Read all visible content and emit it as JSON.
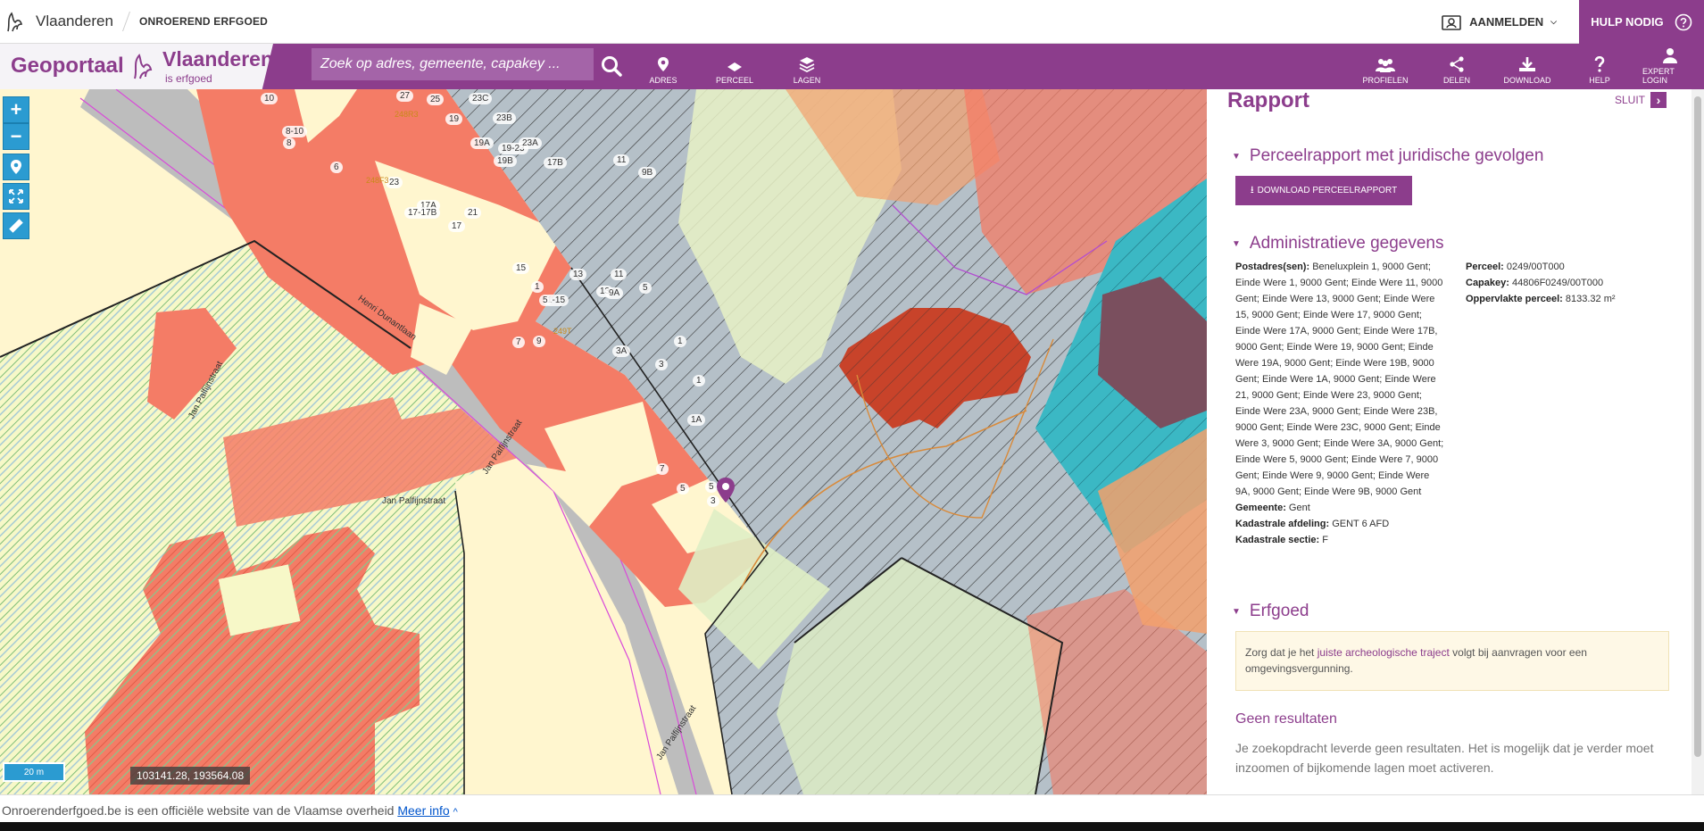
{
  "topbar": {
    "brand": "Vlaanderen",
    "site": "ONROEREND ERFGOED",
    "login": "AANMELDEN",
    "help": "HULP NODIG"
  },
  "header": {
    "geoportaal": "Geoportaal",
    "vlaanderen": "Vlaanderen",
    "is_erfgoed": "is erfgoed",
    "search_placeholder": "Zoek op adres, gemeente, capakey ...",
    "buttons": {
      "adres": "ADRES",
      "perceel": "PERCEEL",
      "lagen": "LAGEN",
      "profielen": "PROFIELEN",
      "delen": "DELEN",
      "download": "DOWNLOAD",
      "help": "HELP",
      "expert_login": "EXPERT LOGIN"
    }
  },
  "map": {
    "coordinates": "103141.28, 193564.08",
    "scale": "20 m",
    "streets": [
      "Henri Dunantlaan",
      "Jan Palfijnstraat",
      "Jan Palfijnstraat",
      "Jan Palfijnstraat",
      "Jan Palfijnstraat"
    ],
    "house_numbers": [
      "10",
      "8-10",
      "8",
      "27",
      "25",
      "23C",
      "19",
      "23B",
      "19A",
      "19-23",
      "23A",
      "19B",
      "6",
      "17B",
      "23",
      "17A",
      "17-17B",
      "21",
      "17",
      "11",
      "9B",
      "15",
      "13",
      "11",
      "1",
      "1-15",
      "13",
      "5",
      "9A",
      "5",
      "9",
      "7",
      "3A",
      "1",
      "3",
      "1",
      "1A",
      "7",
      "5",
      "5",
      "3"
    ],
    "parcel_labels": [
      "248R3",
      "248F3",
      "249T"
    ]
  },
  "panel": {
    "title": "Rapport",
    "close": "SLUIT",
    "section_perceel": "Perceelrapport met juridische gevolgen",
    "download_button": "DOWNLOAD PERCEELRAPPORT",
    "section_admin": "Administratieve gegevens",
    "postadres_label": "Postadres(sen):",
    "postadres_value": "Beneluxplein 1, 9000 Gent; Einde Were 1, 9000 Gent; Einde Were 11, 9000 Gent; Einde Were 13, 9000 Gent; Einde Were 15, 9000 Gent; Einde Were 17, 9000 Gent; Einde Were 17A, 9000 Gent; Einde Were 17B, 9000 Gent; Einde Were 19, 9000 Gent; Einde Were 19A, 9000 Gent; Einde Were 19B, 9000 Gent; Einde Were 1A, 9000 Gent; Einde Were 21, 9000 Gent; Einde Were 23, 9000 Gent; Einde Were 23A, 9000 Gent; Einde Were 23B, 9000 Gent; Einde Were 23C, 9000 Gent; Einde Were 3, 9000 Gent; Einde Were 3A, 9000 Gent; Einde Were 5, 9000 Gent; Einde Were 7, 9000 Gent; Einde Were 9, 9000 Gent; Einde Were 9A, 9000 Gent; Einde Were 9B, 9000 Gent",
    "gemeente_label": "Gemeente:",
    "gemeente_value": "Gent",
    "afdeling_label": "Kadastrale afdeling:",
    "afdeling_value": "GENT 6 AFD",
    "sectie_label": "Kadastrale sectie:",
    "sectie_value": "F",
    "perceel_label": "Perceel:",
    "perceel_value": "0249/00T000",
    "capakey_label": "Capakey:",
    "capakey_value": "44806F0249/00T000",
    "opp_label": "Oppervlakte perceel:",
    "opp_value": "8133.32 m²",
    "section_erfgoed": "Erfgoed",
    "note_pre": "Zorg dat je het",
    "note_link": "juiste archeologische traject",
    "note_post": "volgt bij aanvragen voor een omgevingsvergunning.",
    "geen_title": "Geen resultaten",
    "geen_text": "Je zoekopdracht leverde geen resultaten. Het is mogelijk dat je verder moet inzoomen of bijkomende lagen moet activeren."
  },
  "footer": {
    "text": "Onroerenderfgoed.be is een officiële website van de Vlaamse overheid",
    "link": "Meer info"
  },
  "colors": {
    "brand_purple": "#8c3d8c",
    "map_blue": "#2b9bd1",
    "parcel_red": "#f47c66",
    "cream": "#fff6cf"
  }
}
